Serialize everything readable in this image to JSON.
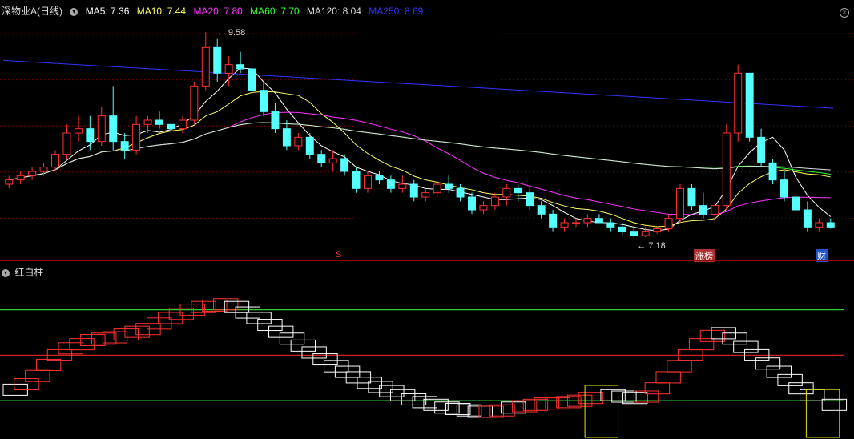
{
  "header": {
    "stock_name": "深物业A(日线)",
    "ma": [
      {
        "label": "MA5: 7.36",
        "color": "#ffffff"
      },
      {
        "label": "MA10: 7.44",
        "color": "#ffff66"
      },
      {
        "label": "MA20: 7.80",
        "color": "#ff33ff"
      },
      {
        "label": "MA60: 7.70",
        "color": "#33ff33"
      },
      {
        "label": "MA120: 8.04",
        "color": "#dddddd"
      },
      {
        "label": "MA250: 8.69",
        "color": "#3333ff"
      }
    ]
  },
  "indicator": {
    "name": "红白柱"
  },
  "annotations": {
    "high_label": "9.58",
    "low_label": "7.18",
    "tag_s": "S",
    "tag_zhangting": "涨榜",
    "tag_cai": "财"
  },
  "colors": {
    "up": "#ff3333",
    "down": "#54ffff",
    "bg": "#000000",
    "grid": "#8b0000"
  },
  "chart_data": {
    "type": "candlestick",
    "series": [
      {
        "name": "K线",
        "ohlc": [
          [
            7.8,
            7.9,
            7.75,
            7.85
          ],
          [
            7.85,
            7.95,
            7.8,
            7.9
          ],
          [
            7.9,
            8.0,
            7.85,
            7.95
          ],
          [
            7.95,
            8.05,
            7.9,
            8.0
          ],
          [
            8.0,
            8.2,
            7.95,
            8.15
          ],
          [
            8.15,
            8.5,
            8.1,
            8.4
          ],
          [
            8.4,
            8.6,
            8.3,
            8.45
          ],
          [
            8.45,
            8.6,
            8.2,
            8.3
          ],
          [
            8.3,
            8.7,
            8.25,
            8.6
          ],
          [
            8.6,
            8.95,
            8.2,
            8.3
          ],
          [
            8.3,
            8.4,
            8.1,
            8.2
          ],
          [
            8.2,
            8.6,
            8.15,
            8.5
          ],
          [
            8.5,
            8.6,
            8.4,
            8.55
          ],
          [
            8.55,
            8.65,
            8.45,
            8.5
          ],
          [
            8.5,
            8.55,
            8.4,
            8.45
          ],
          [
            8.45,
            8.6,
            8.4,
            8.55
          ],
          [
            8.55,
            9.0,
            8.5,
            8.95
          ],
          [
            8.95,
            9.58,
            8.9,
            9.4
          ],
          [
            9.4,
            9.5,
            9.0,
            9.1
          ],
          [
            9.1,
            9.3,
            8.95,
            9.2
          ],
          [
            9.2,
            9.35,
            9.1,
            9.15
          ],
          [
            9.15,
            9.25,
            8.85,
            8.9
          ],
          [
            8.9,
            9.0,
            8.6,
            8.65
          ],
          [
            8.65,
            8.75,
            8.4,
            8.45
          ],
          [
            8.45,
            8.55,
            8.2,
            8.25
          ],
          [
            8.25,
            8.4,
            8.2,
            8.35
          ],
          [
            8.35,
            8.4,
            8.1,
            8.15
          ],
          [
            8.15,
            8.2,
            8.0,
            8.05
          ],
          [
            8.05,
            8.2,
            7.95,
            8.1
          ],
          [
            8.1,
            8.15,
            7.9,
            7.95
          ],
          [
            7.95,
            8.0,
            7.7,
            7.75
          ],
          [
            7.75,
            7.95,
            7.7,
            7.9
          ],
          [
            7.9,
            7.95,
            7.8,
            7.85
          ],
          [
            7.85,
            7.9,
            7.7,
            7.75
          ],
          [
            7.75,
            7.9,
            7.7,
            7.8
          ],
          [
            7.8,
            7.85,
            7.6,
            7.65
          ],
          [
            7.65,
            7.75,
            7.6,
            7.7
          ],
          [
            7.7,
            7.85,
            7.65,
            7.8
          ],
          [
            7.8,
            7.9,
            7.7,
            7.75
          ],
          [
            7.75,
            7.8,
            7.6,
            7.65
          ],
          [
            7.65,
            7.7,
            7.45,
            7.5
          ],
          [
            7.5,
            7.6,
            7.45,
            7.55
          ],
          [
            7.55,
            7.7,
            7.5,
            7.65
          ],
          [
            7.65,
            7.8,
            7.55,
            7.75
          ],
          [
            7.75,
            7.8,
            7.6,
            7.7
          ],
          [
            7.7,
            7.75,
            7.5,
            7.55
          ],
          [
            7.55,
            7.6,
            7.4,
            7.45
          ],
          [
            7.45,
            7.5,
            7.25,
            7.3
          ],
          [
            7.3,
            7.4,
            7.25,
            7.35
          ],
          [
            7.35,
            7.4,
            7.3,
            7.35
          ],
          [
            7.35,
            7.45,
            7.3,
            7.4
          ],
          [
            7.4,
            7.45,
            7.35,
            7.35
          ],
          [
            7.35,
            7.4,
            7.25,
            7.3
          ],
          [
            7.3,
            7.35,
            7.2,
            7.25
          ],
          [
            7.25,
            7.3,
            7.18,
            7.2
          ],
          [
            7.2,
            7.3,
            7.18,
            7.25
          ],
          [
            7.25,
            7.3,
            7.22,
            7.28
          ],
          [
            7.28,
            7.45,
            7.25,
            7.4
          ],
          [
            7.4,
            7.8,
            7.35,
            7.75
          ],
          [
            7.75,
            7.8,
            7.5,
            7.55
          ],
          [
            7.55,
            7.7,
            7.4,
            7.45
          ],
          [
            7.45,
            7.6,
            7.35,
            7.55
          ],
          [
            7.55,
            8.5,
            7.5,
            8.4
          ],
          [
            8.4,
            9.2,
            8.3,
            9.1
          ],
          [
            9.1,
            9.1,
            8.3,
            8.35
          ],
          [
            8.35,
            8.45,
            8.0,
            8.05
          ],
          [
            8.05,
            8.1,
            7.8,
            7.85
          ],
          [
            7.85,
            7.95,
            7.6,
            7.65
          ],
          [
            7.65,
            7.7,
            7.45,
            7.5
          ],
          [
            7.5,
            7.6,
            7.25,
            7.3
          ],
          [
            7.3,
            7.4,
            7.25,
            7.35
          ],
          [
            7.35,
            7.4,
            7.28,
            7.3
          ]
        ]
      }
    ],
    "ylim": [
      7.05,
      9.75
    ],
    "grid": true
  },
  "red_white_bars": {
    "ylim": [
      0,
      100
    ],
    "levels": [
      {
        "value": 88,
        "color": "#33cc33"
      },
      {
        "value": 55,
        "color": "#cc2222"
      },
      {
        "value": 22,
        "color": "#33cc33"
      }
    ],
    "values": [
      30,
      34,
      40,
      48,
      55,
      60,
      63,
      66,
      67,
      68,
      70,
      72,
      74,
      78,
      82,
      85,
      88,
      90,
      91,
      92,
      90,
      86,
      82,
      77,
      72,
      67,
      62,
      57,
      52,
      47,
      43,
      39,
      35,
      32,
      29,
      26,
      23,
      21,
      19,
      17,
      16,
      15,
      14,
      14,
      15,
      17,
      18,
      19,
      20,
      20,
      21,
      22,
      24,
      25,
      26,
      25,
      24,
      25,
      31,
      39,
      47,
      55,
      63,
      69,
      71,
      67,
      61,
      55,
      49,
      43,
      37,
      31,
      26,
      22,
      19
    ],
    "colors": [
      "w",
      "r",
      "r",
      "r",
      "r",
      "r",
      "r",
      "r",
      "r",
      "r",
      "r",
      "r",
      "r",
      "r",
      "r",
      "r",
      "r",
      "r",
      "r",
      "r",
      "w",
      "w",
      "w",
      "w",
      "w",
      "w",
      "w",
      "w",
      "w",
      "w",
      "w",
      "w",
      "w",
      "w",
      "w",
      "w",
      "w",
      "w",
      "w",
      "w",
      "w",
      "w",
      "w",
      "r",
      "r",
      "w",
      "r",
      "r",
      "r",
      "r",
      "r",
      "r",
      "r",
      "y",
      "w",
      "w",
      "w",
      "r",
      "r",
      "r",
      "r",
      "r",
      "r",
      "r",
      "w",
      "w",
      "w",
      "w",
      "w",
      "w",
      "w",
      "w",
      "w",
      "y",
      "w"
    ]
  }
}
